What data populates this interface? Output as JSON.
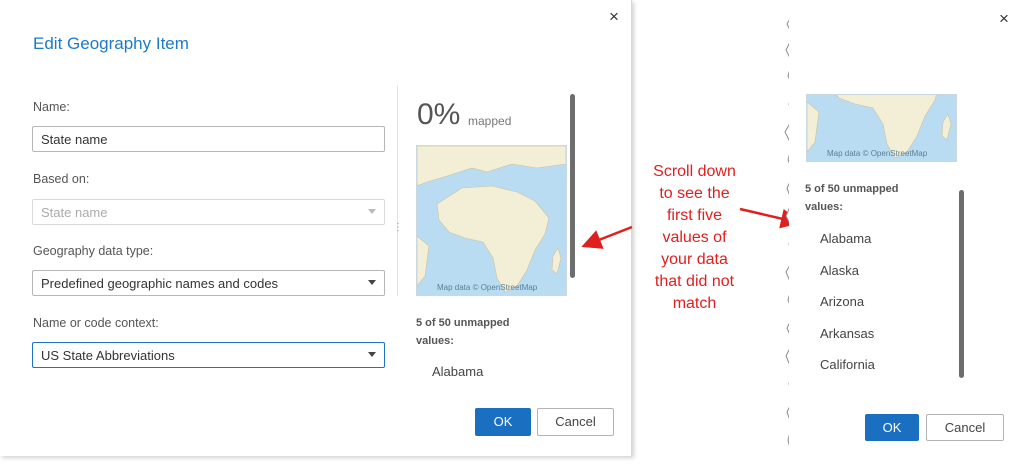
{
  "left_dialog": {
    "title": "Edit Geography Item",
    "close_glyph": "×",
    "fields": {
      "name_label": "Name:",
      "name_value": "State name",
      "based_on_label": "Based on:",
      "based_on_value": "State name",
      "data_type_label": "Geography data type:",
      "data_type_value": "Predefined geographic names and codes",
      "context_label": "Name or code context:",
      "context_value": "US State Abbreviations"
    },
    "preview": {
      "percent": "0%",
      "mapped_label": "mapped",
      "map_attribution": "Map data © OpenStreetMap",
      "unmapped_line1": "5 of 50 unmapped",
      "unmapped_line2": "values:",
      "first_value": "Alabama"
    },
    "ok_label": "OK",
    "cancel_label": "Cancel"
  },
  "annotation": {
    "lines": [
      "Scroll down",
      "to see the",
      "first five",
      "values of",
      "your data",
      "that did not",
      "match"
    ],
    "color": "#e01f1f"
  },
  "right_dialog": {
    "close_glyph": "×",
    "map_attribution": "Map data © OpenStreetMap",
    "unmapped_line1": "5 of 50 unmapped",
    "unmapped_line2": "values:",
    "values": [
      "Alabama",
      "Alaska",
      "Arizona",
      "Arkansas",
      "California"
    ],
    "ok_label": "OK",
    "cancel_label": "Cancel"
  },
  "colors": {
    "accent": "#1e7ac4",
    "primary_button": "#1b6fc0",
    "map_water": "#b9dcf3",
    "map_land": "#f3efd6"
  },
  "icons": [
    "close-icon",
    "dropdown-caret-icon",
    "resize-grip-icon",
    "arrow-icon"
  ]
}
